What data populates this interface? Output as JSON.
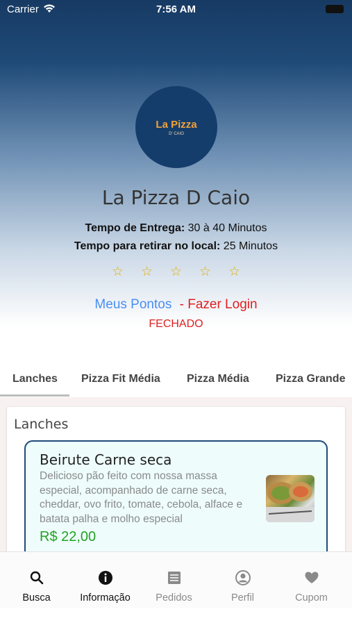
{
  "status_bar": {
    "carrier": "Carrier",
    "time": "7:56 AM"
  },
  "store": {
    "logo_text": "La Pizza",
    "logo_sub": "D' CAIO",
    "name": "La Pizza D Caio",
    "delivery_label": "Tempo de Entrega:",
    "delivery_value": "30 à 40 Minutos",
    "pickup_label": "Tempo para retirar no local:",
    "pickup_value": "25 Minutos",
    "rating_stars": 0,
    "points_link": "Meus Pontos",
    "login_link": "- Fazer Login",
    "status": "FECHADO"
  },
  "tabs": [
    {
      "label": "Lanches",
      "active": true
    },
    {
      "label": "Pizza Fit Média",
      "active": false
    },
    {
      "label": "Pizza Média",
      "active": false
    },
    {
      "label": "Pizza Grande",
      "active": false
    }
  ],
  "section": {
    "title": "Lanches",
    "products": [
      {
        "name": "Beirute Carne seca",
        "description": "Delicioso pão feito com nossa massa especial, acompanhado de carne seca, cheddar, ovo frito, tomate, cebola, alface e batata palha e molho especial",
        "price": "R$ 22,00"
      }
    ]
  },
  "bottom_nav": [
    {
      "label": "Busca",
      "icon": "search-icon",
      "active": true
    },
    {
      "label": "Informação",
      "icon": "info-icon",
      "active": true
    },
    {
      "label": "Pedidos",
      "icon": "list-icon",
      "active": false
    },
    {
      "label": "Perfil",
      "icon": "profile-icon",
      "active": false
    },
    {
      "label": "Cupom",
      "icon": "heart-icon",
      "active": false
    }
  ],
  "colors": {
    "header_top": "#173a63",
    "accent_blue": "#4a8ef0",
    "alert_red": "#e02020",
    "price_green": "#22a222",
    "star_gold": "#e0b000"
  }
}
